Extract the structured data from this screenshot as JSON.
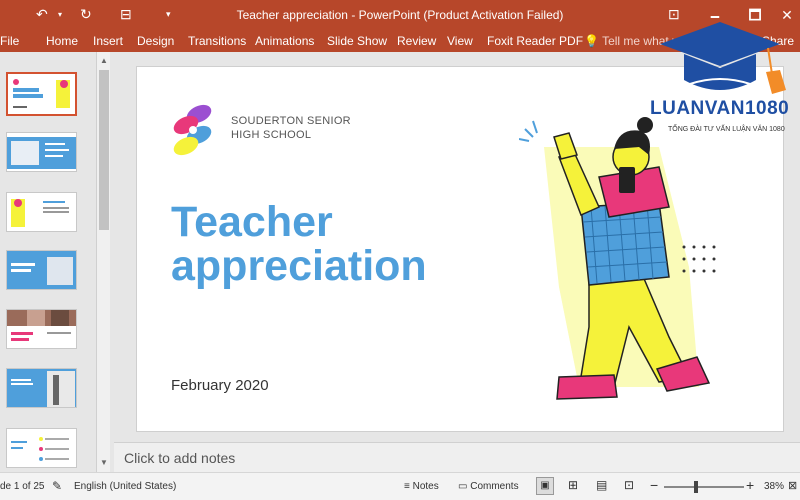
{
  "window": {
    "title": "Teacher appreciation - PowerPoint (Product Activation Failed)",
    "controls": [
      "🗕",
      "🗖",
      "✕"
    ]
  },
  "ribbon": {
    "tabs": [
      "File",
      "Home",
      "Insert",
      "Design",
      "Transitions",
      "Animations",
      "Slide Show",
      "Review",
      "View",
      "Foxit Reader PDF"
    ],
    "tell_me": "Tell me what you",
    "share": "Share"
  },
  "slide": {
    "school_line1": "SOUDERTON SENIOR",
    "school_line2": "HIGH SCHOOL",
    "title_line1": "Teacher",
    "title_line2": "appreciation",
    "date": "February 2020"
  },
  "notes": {
    "placeholder": "Click to add notes"
  },
  "statusbar": {
    "slide_info": "de 1 of 25",
    "language": "English (United States)",
    "notes_label": "Notes",
    "comments_label": "Comments",
    "zoom": "38%"
  },
  "watermark": {
    "brand": "LUANVAN1080",
    "tagline": "TỔNG ĐÀI TƯ VẤN LUẬN VĂN 1080"
  },
  "colors": {
    "accent": "#b7472a",
    "title_blue": "#4f9fdb",
    "yellow": "#f5f23a",
    "pink": "#e8387a"
  }
}
